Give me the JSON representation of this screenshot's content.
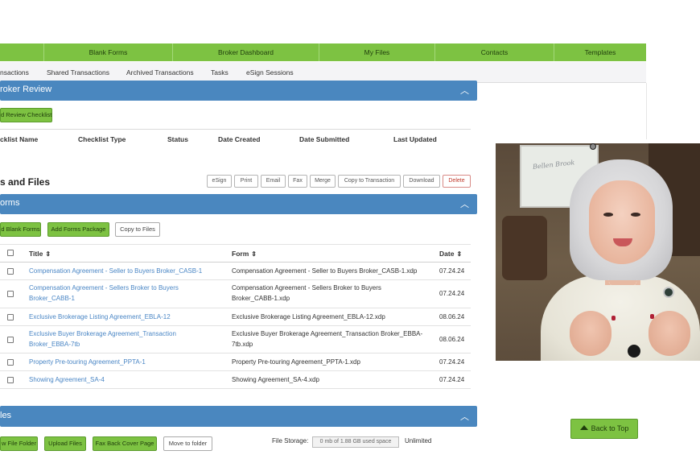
{
  "top_nav": {
    "items": [
      {
        "label": ""
      },
      {
        "label": "Blank Forms"
      },
      {
        "label": "Broker Dashboard"
      },
      {
        "label": "My Files"
      },
      {
        "label": "Contacts"
      },
      {
        "label": "Templates"
      }
    ]
  },
  "sub_nav": {
    "items": [
      {
        "label": "nsactions"
      },
      {
        "label": "Shared Transactions"
      },
      {
        "label": "Archived Transactions"
      },
      {
        "label": "Tasks"
      },
      {
        "label": "eSign Sessions"
      }
    ]
  },
  "broker_review": {
    "title": "roker Review",
    "add_checklist_label": "d Review Checklist",
    "columns": [
      "cklist Name",
      "Checklist Type",
      "Status",
      "Date Created",
      "Date Submitted",
      "Last Updated"
    ]
  },
  "forms_files": {
    "heading": "s and Files",
    "toolbar": [
      "eSign",
      "Print",
      "Email",
      "Fax",
      "Merge",
      "Copy to Transaction",
      "Download",
      "Delete"
    ]
  },
  "forms_section": {
    "title": "orms",
    "buttons": {
      "add_blank": "d Blank Forms",
      "add_package": "Add Forms Package",
      "copy_files": "Copy to Files"
    },
    "columns": {
      "title": "Title",
      "form": "Form",
      "date": "Date"
    },
    "sort_glyph": "⇕",
    "rows": [
      {
        "title": [
          "Compensation Agreement - Seller to Buyers Broker_CASB-1"
        ],
        "form": [
          "Compensation Agreement - Seller to Buyers Broker_CASB-1.xdp"
        ],
        "date": "07.24.24"
      },
      {
        "title": [
          "Compensation Agreement - Sellers Broker to Buyers",
          "Broker_CABB-1"
        ],
        "form": [
          "Compensation Agreement - Sellers Broker to Buyers",
          "Broker_CABB-1.xdp"
        ],
        "date": "07.24.24"
      },
      {
        "title": [
          "Exclusive Brokerage Listing Agreement_EBLA-12"
        ],
        "form": [
          "Exclusive Brokerage Listing Agreement_EBLA-12.xdp"
        ],
        "date": "08.06.24"
      },
      {
        "title": [
          "Exclusive Buyer Brokerage Agreement_Transaction",
          "Broker_EBBA-7tb"
        ],
        "form": [
          "Exclusive Buyer Brokerage Agreement_Transaction Broker_EBBA-",
          "7tb.xdp"
        ],
        "date": "08.06.24"
      },
      {
        "title": [
          "Property Pre-touring Agreement_PPTA-1"
        ],
        "form": [
          "Property Pre-touring Agreement_PPTA-1.xdp"
        ],
        "date": "07.24.24"
      },
      {
        "title": [
          "Showing Agreement_SA-4"
        ],
        "form": [
          "Showing Agreement_SA-4.xdp"
        ],
        "date": "07.24.24"
      }
    ]
  },
  "files_section": {
    "title": "les",
    "buttons": {
      "new_folder": "w File Folder",
      "upload": "Upload Files",
      "fax_cover": "Fax Back Cover Page",
      "move": "Move to folder"
    },
    "storage_label": "File Storage:",
    "storage_value": "0 mb of 1.88 GB used space",
    "unlimited": "Unlimited"
  },
  "back_to_top": "Back to Top",
  "webcam": {
    "board_text": "Bellen  Brook"
  },
  "colors": {
    "nav_green": "#7dc242",
    "section_blue": "#4a87bf",
    "link_blue": "#4a86c5",
    "delete_red": "#c0392b"
  }
}
